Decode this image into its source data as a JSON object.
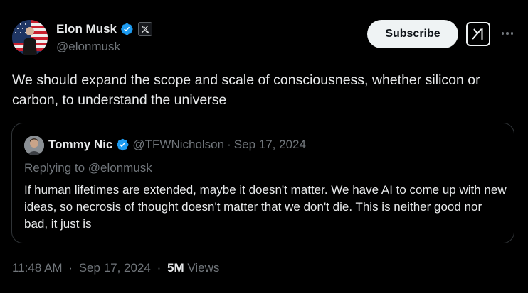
{
  "author": {
    "name": "Elon Musk",
    "handle": "@elonmusk"
  },
  "actions": {
    "subscribe_label": "Subscribe"
  },
  "tweet": {
    "text": "We should expand the scope and scale of consciousness, whether silicon or carbon, to understand the universe"
  },
  "quoted": {
    "name": "Tommy Nic",
    "handle": "@TFWNicholson",
    "separator": "·",
    "date": "Sep 17, 2024",
    "replying_to": "Replying to @elonmusk",
    "text": "If human lifetimes are extended, maybe it doesn't matter. We have AI to come up with new ideas, so necrosis of thought doesn't matter that we don't die. This is neither good nor bad, it just is"
  },
  "footer": {
    "time": "11:48 AM",
    "separator": "·",
    "date": "Sep 17, 2024",
    "views_count": "5M",
    "views_label": "Views"
  },
  "colors": {
    "background": "#000000",
    "text": "#e7e9ea",
    "muted": "#71767b",
    "verified": "#1d9bf0",
    "border": "#2f3336"
  },
  "icons": {
    "verified": "verified-badge-icon",
    "affiliate": "x-logo-icon",
    "grok": "grok-icon",
    "more": "more-dots-icon"
  }
}
